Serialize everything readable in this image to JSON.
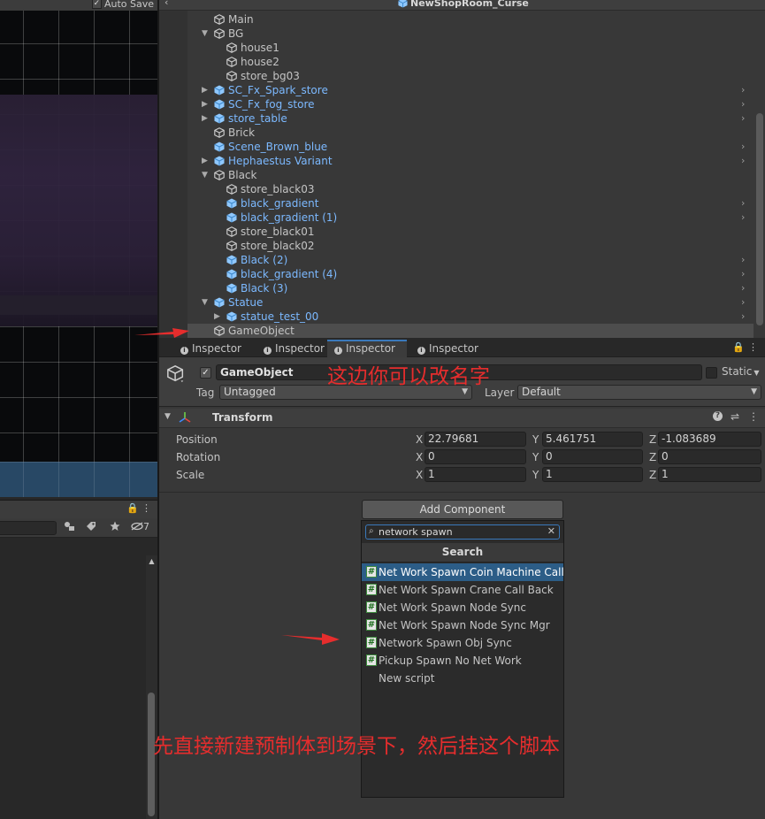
{
  "scene_view": {
    "auto_save_check": "✓",
    "auto_save_label": "Auto Save"
  },
  "hierarchy": {
    "back_glyph": "‹",
    "scene_title": "NewShopRoom_Curse",
    "rows": [
      {
        "label": "Main",
        "depth": 1,
        "prefab": false,
        "expand": "",
        "chevron": false,
        "selected": false
      },
      {
        "label": "BG",
        "depth": 1,
        "prefab": false,
        "expand": "▼",
        "chevron": false,
        "selected": false
      },
      {
        "label": "house1",
        "depth": 2,
        "prefab": false,
        "expand": "",
        "chevron": false,
        "selected": false
      },
      {
        "label": "house2",
        "depth": 2,
        "prefab": false,
        "expand": "",
        "chevron": false,
        "selected": false
      },
      {
        "label": "store_bg03",
        "depth": 2,
        "prefab": false,
        "expand": "",
        "chevron": false,
        "selected": false
      },
      {
        "label": "SC_Fx_Spark_store",
        "depth": 1,
        "prefab": true,
        "expand": "▶",
        "chevron": true,
        "selected": false
      },
      {
        "label": "SC_Fx_fog_store",
        "depth": 1,
        "prefab": true,
        "expand": "▶",
        "chevron": true,
        "selected": false
      },
      {
        "label": "store_table",
        "depth": 1,
        "prefab": true,
        "expand": "▶",
        "chevron": true,
        "selected": false
      },
      {
        "label": "Brick",
        "depth": 1,
        "prefab": false,
        "expand": "",
        "chevron": false,
        "selected": false
      },
      {
        "label": "Scene_Brown_blue",
        "depth": 1,
        "prefab": true,
        "expand": "",
        "chevron": true,
        "selected": false
      },
      {
        "label": "Hephaestus Variant",
        "depth": 1,
        "prefab": true,
        "expand": "▶",
        "chevron": true,
        "selected": false
      },
      {
        "label": "Black",
        "depth": 1,
        "prefab": false,
        "expand": "▼",
        "chevron": false,
        "selected": false
      },
      {
        "label": "store_black03",
        "depth": 2,
        "prefab": false,
        "expand": "",
        "chevron": false,
        "selected": false
      },
      {
        "label": "black_gradient",
        "depth": 2,
        "prefab": true,
        "expand": "",
        "chevron": true,
        "selected": false
      },
      {
        "label": "black_gradient (1)",
        "depth": 2,
        "prefab": true,
        "expand": "",
        "chevron": true,
        "selected": false
      },
      {
        "label": "store_black01",
        "depth": 2,
        "prefab": false,
        "expand": "",
        "chevron": false,
        "selected": false
      },
      {
        "label": "store_black02",
        "depth": 2,
        "prefab": false,
        "expand": "",
        "chevron": false,
        "selected": false
      },
      {
        "label": "Black (2)",
        "depth": 2,
        "prefab": true,
        "expand": "",
        "chevron": true,
        "selected": false
      },
      {
        "label": "black_gradient (4)",
        "depth": 2,
        "prefab": true,
        "expand": "",
        "chevron": true,
        "selected": false
      },
      {
        "label": "Black (3)",
        "depth": 2,
        "prefab": true,
        "expand": "",
        "chevron": true,
        "selected": false
      },
      {
        "label": "Statue",
        "depth": 1,
        "prefab": true,
        "expand": "▼",
        "chevron": true,
        "selected": false
      },
      {
        "label": "statue_test_00",
        "depth": 2,
        "prefab": true,
        "expand": "▶",
        "chevron": true,
        "selected": false
      },
      {
        "label": "GameObject",
        "depth": 1,
        "prefab": false,
        "expand": "",
        "chevron": false,
        "selected": true
      }
    ],
    "chevron_glyph": "›"
  },
  "project_panel": {
    "lock_glyph": "🔒",
    "menu_glyph": "⋮",
    "hidden_count": "7"
  },
  "inspector": {
    "tabs": [
      "Inspector",
      "Inspector",
      "Inspector",
      "Inspector"
    ],
    "active_tab_index": 2,
    "lock_glyph": "🔒",
    "menu_glyph": "⋮",
    "object_name": "GameObject",
    "active_check": "✓",
    "static_label": "Static",
    "tag_label": "Tag",
    "tag_value": "Untagged",
    "layer_label": "Layer",
    "layer_value": "Default",
    "dropdown_arrow": "▼",
    "transform": {
      "title": "Transform",
      "help_glyph": "?",
      "presets_glyph": "⇌",
      "menu_glyph": "⋮",
      "rows": [
        {
          "label": "Position",
          "x": "22.79681",
          "y": "5.461751",
          "z": "-1.083689"
        },
        {
          "label": "Rotation",
          "x": "0",
          "y": "0",
          "z": "0"
        },
        {
          "label": "Scale",
          "x": "1",
          "y": "1",
          "z": "1"
        }
      ],
      "axis_x": "X",
      "axis_y": "Y",
      "axis_z": "Z"
    },
    "add_component_label": "Add Component",
    "add_component_popup": {
      "search_icon": "⌕",
      "search_value": "network spawn",
      "clear_glyph": "✕",
      "title": "Search",
      "hash_glyph": "#",
      "results": [
        {
          "label": "Net Work Spawn Coin Machine Call Back",
          "selected": true,
          "script": true
        },
        {
          "label": "Net Work Spawn Crane Call Back",
          "selected": false,
          "script": true
        },
        {
          "label": "Net Work Spawn Node Sync",
          "selected": false,
          "script": true
        },
        {
          "label": "Net Work Spawn Node Sync Mgr",
          "selected": false,
          "script": true
        },
        {
          "label": "Network Spawn Obj Sync",
          "selected": false,
          "script": true
        },
        {
          "label": "Pickup Spawn No Net Work",
          "selected": false,
          "script": true
        },
        {
          "label": "New script",
          "selected": false,
          "script": false
        }
      ]
    }
  },
  "annotations": {
    "rename_note": "这边你可以改名字",
    "instruction_note": "先直接新建预制体到场景下，然后挂这个脚本"
  },
  "colors": {
    "annotation_red": "#e62d2d",
    "prefab_blue": "#7cb9ff",
    "selection_blue": "#2c5d87",
    "accent": "#3a79bb"
  }
}
